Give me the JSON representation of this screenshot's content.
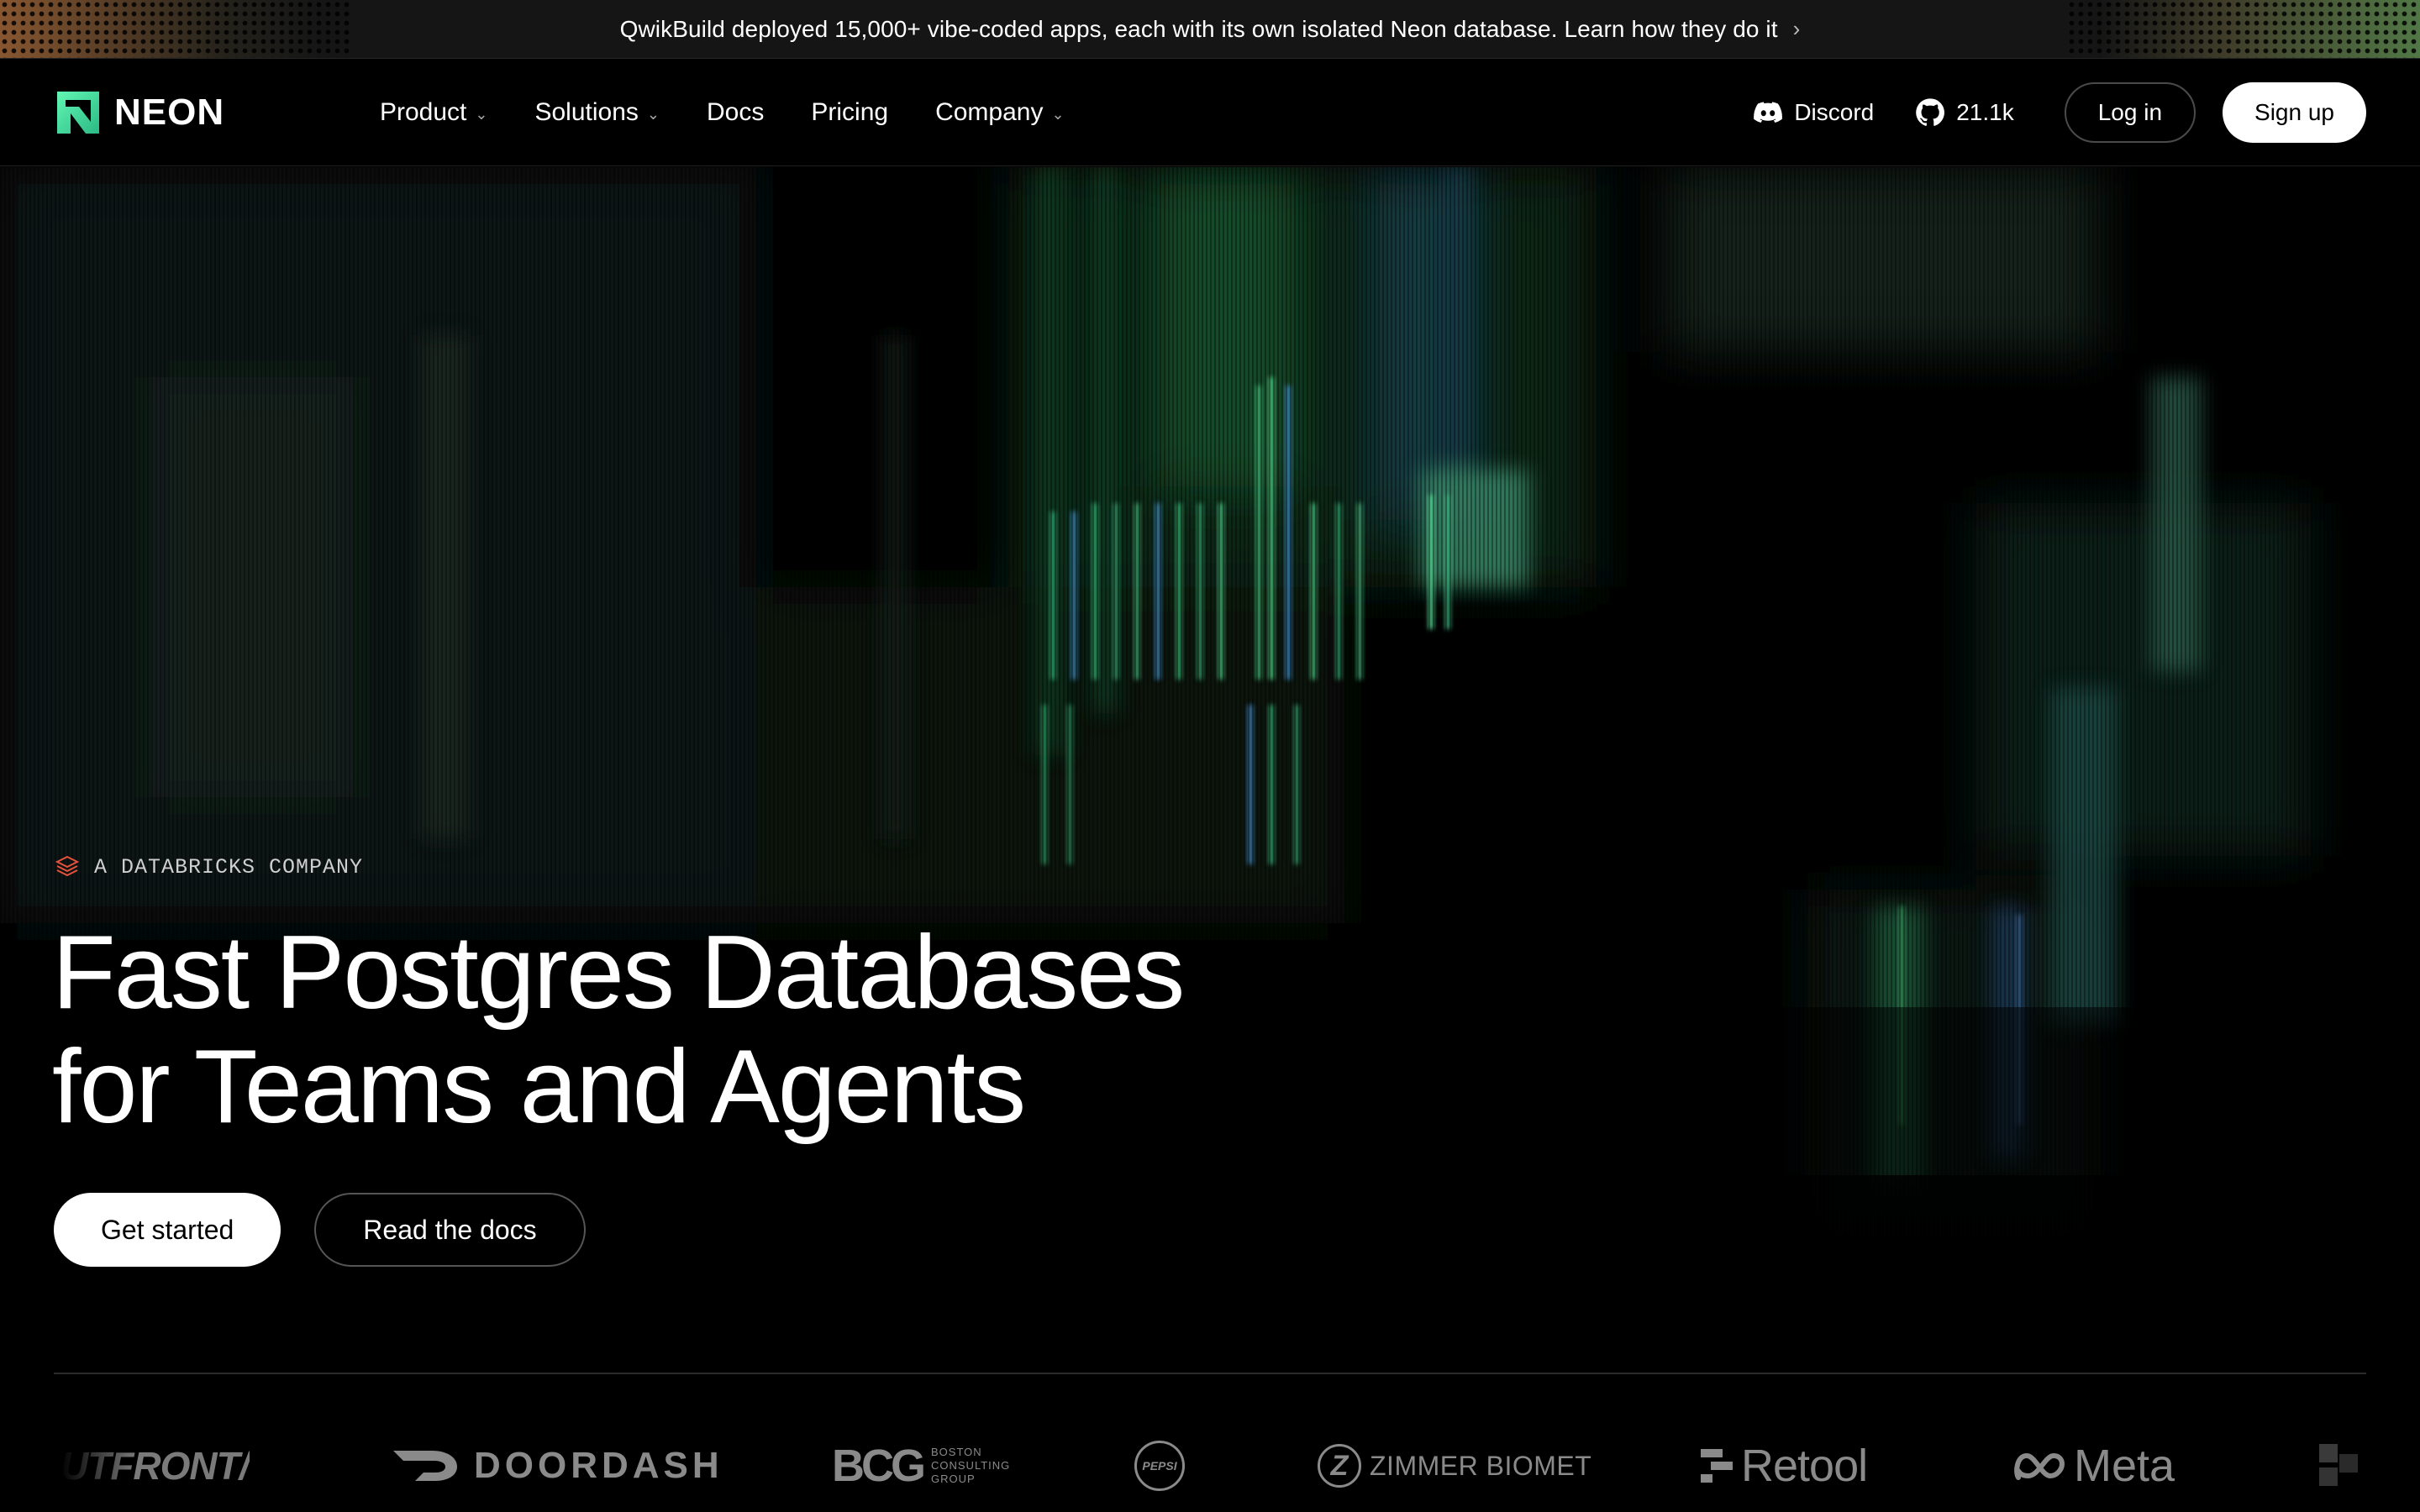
{
  "announcement": {
    "text": "QwikBuild deployed 15,000+ vibe-coded apps, each with its own isolated Neon database. Learn how they do it",
    "chevron": "›"
  },
  "header": {
    "logo_text": "NEON",
    "nav": [
      {
        "label": "Product",
        "has_dropdown": true
      },
      {
        "label": "Solutions",
        "has_dropdown": true
      },
      {
        "label": "Docs",
        "has_dropdown": false
      },
      {
        "label": "Pricing",
        "has_dropdown": false
      },
      {
        "label": "Company",
        "has_dropdown": true
      }
    ],
    "discord_label": "Discord",
    "github_stars": "21.1k",
    "login_label": "Log in",
    "signup_label": "Sign up"
  },
  "hero": {
    "eyebrow": "A DATABRICKS COMPANY",
    "headline_line1": "Fast Postgres Databases",
    "headline_line2": "for Teams and Agents",
    "cta_primary": "Get started",
    "cta_secondary": "Read the docs"
  },
  "logos": {
    "utfront": "UTFRONT/",
    "doordash": "DOORDASH",
    "bcg": "BCG",
    "bcg_sub_1": "BOSTON",
    "bcg_sub_2": "CONSULTING",
    "bcg_sub_3": "GROUP",
    "pepsi": "PEPSI",
    "zimmer": "ZIMMER BIOMET",
    "zimmer_mark": "Z",
    "retool": "Retool",
    "meta": "Meta"
  },
  "colors": {
    "brand_green": "#34d59a",
    "background": "#000000",
    "databricks_red": "#e5533d"
  }
}
